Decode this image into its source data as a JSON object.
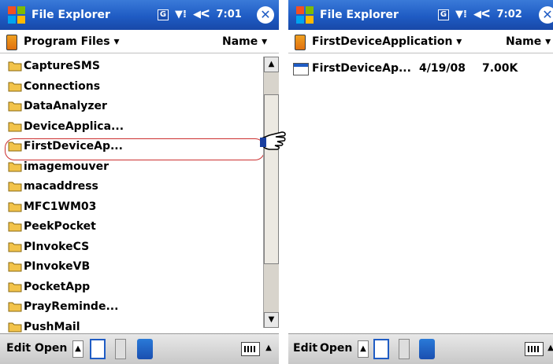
{
  "left": {
    "title": "File Explorer",
    "status": {
      "g": "G",
      "time": "7:01"
    },
    "path": "Program Files",
    "sort": "Name",
    "items": [
      "CaptureSMS",
      "Connections",
      "DataAnalyzer",
      "DeviceApplica...",
      "FirstDeviceAp...",
      "imagemouver",
      "macaddress",
      "MFC1WM03",
      "PeekPocket",
      "PInvokeCS",
      "PInvokeVB",
      "PocketApp",
      "PrayReminde...",
      "PushMail"
    ],
    "menu": {
      "edit": "Edit",
      "open": "Open"
    }
  },
  "right": {
    "title": "File Explorer",
    "status": {
      "g": "G",
      "time": "7:02"
    },
    "path": "FirstDeviceApplication",
    "sort": "Name",
    "file": {
      "name": "FirstDeviceAp...",
      "date": "4/19/08",
      "size": "7.00K"
    },
    "menu": {
      "edit": "Edit",
      "open": "Open"
    }
  },
  "colors": {
    "titlebar": "#1f5cc4",
    "highlight": "#cc3030",
    "folder": "#f2c34a"
  }
}
